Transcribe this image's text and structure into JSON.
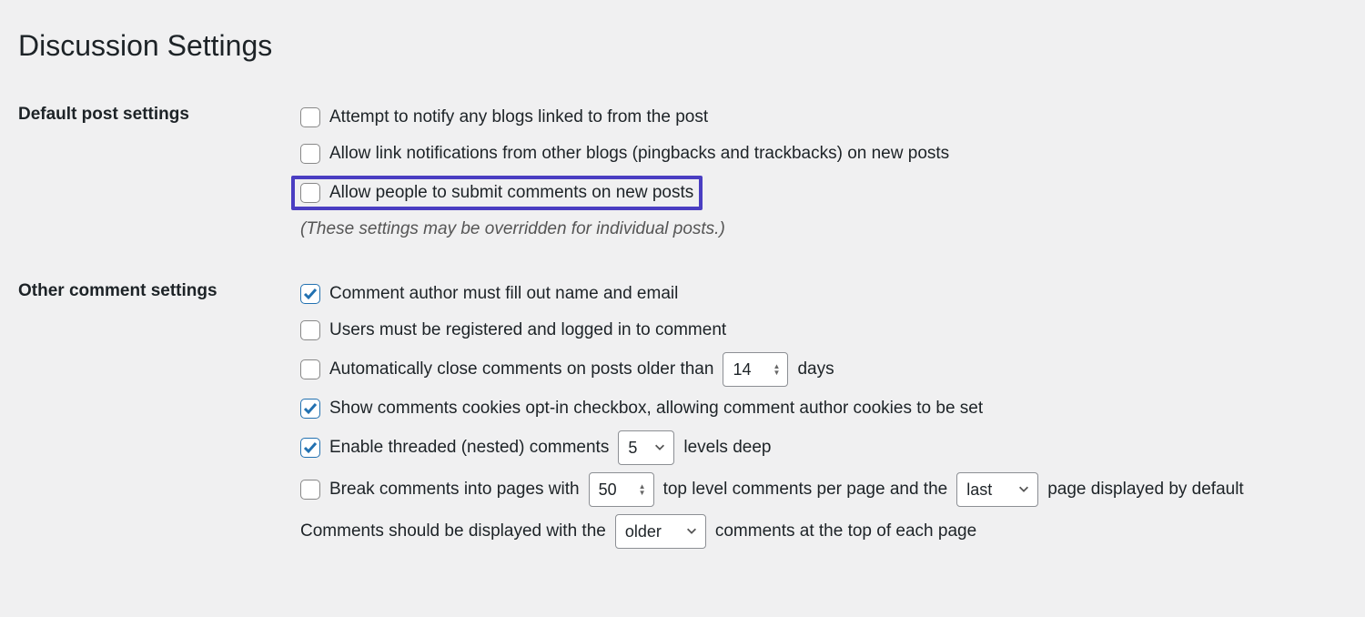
{
  "page_title": "Discussion Settings",
  "sections": {
    "default_post": {
      "heading": "Default post settings",
      "opt_notify": "Attempt to notify any blogs linked to from the post",
      "opt_pingback": "Allow link notifications from other blogs (pingbacks and trackbacks) on new posts",
      "opt_comments": "Allow people to submit comments on new posts",
      "note": "(These settings may be overridden for individual posts.)"
    },
    "other_comment": {
      "heading": "Other comment settings",
      "opt_author_fill": "Comment author must fill out name and email",
      "opt_registered": "Users must be registered and logged in to comment",
      "opt_auto_close_pre": "Automatically close comments on posts older than",
      "opt_auto_close_days_value": "14",
      "opt_auto_close_post": "days",
      "opt_cookies": "Show comments cookies opt-in checkbox, allowing comment author cookies to be set",
      "opt_threaded_pre": "Enable threaded (nested) comments",
      "opt_threaded_value": "5",
      "opt_threaded_post": "levels deep",
      "opt_break_pre": "Break comments into pages with",
      "opt_break_value": "50",
      "opt_break_mid": "top level comments per page and the",
      "opt_break_page_value": "last",
      "opt_break_post": "page displayed by default",
      "opt_order_pre": "Comments should be displayed with the",
      "opt_order_value": "older",
      "opt_order_post": "comments at the top of each page"
    }
  }
}
